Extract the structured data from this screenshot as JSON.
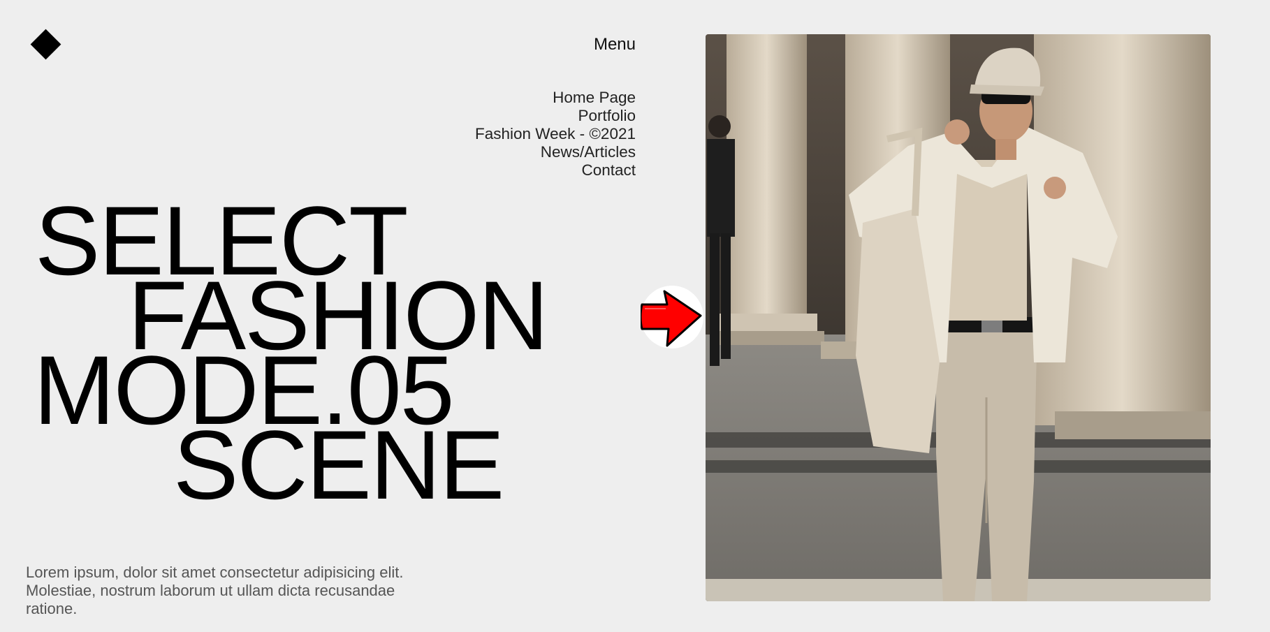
{
  "brand": {
    "logo_icon": "diamond-icon"
  },
  "header": {
    "menu_label": "Menu"
  },
  "nav": {
    "items": [
      {
        "label": "Home Page"
      },
      {
        "label": "Portfolio"
      },
      {
        "label": "Fashion Week - ©2021"
      },
      {
        "label": "News/Articles"
      },
      {
        "label": "Contact"
      }
    ]
  },
  "hero": {
    "line1": "SELECT",
    "line2": "FASHION",
    "line3": "MODE.05",
    "line4": "SCENE"
  },
  "description": "Lorem ipsum, dolor sit amet consectetur adipisicing elit. Molestiae, nostrum laborum ut ullam dicta recusandae ratione.",
  "next_button": {
    "icon": "red-arrow-right-icon",
    "color": "#ff0000"
  },
  "media": {
    "icon": "fashion-video-frame"
  },
  "colors": {
    "background": "#eeeeee",
    "text": "#000000",
    "muted": "#555555"
  }
}
